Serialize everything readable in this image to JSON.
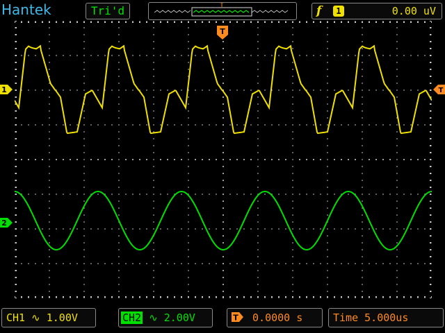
{
  "header": {
    "brand": "Hantek",
    "trigger_status": "Tri'd",
    "trigger_marker_label": "T",
    "trigger_edge_symbol": "f",
    "trigger_source": "1",
    "trigger_level": "0.00  uV"
  },
  "markers": {
    "ch1_label": "1",
    "ch2_label": "2",
    "trigger_pos_label": "T"
  },
  "footer": {
    "ch1_name": "CH1",
    "ch1_coupling_symbol": "∿",
    "ch1_scale": "1.00V",
    "ch2_name": "CH2",
    "ch2_coupling_symbol": "∿",
    "ch2_scale": "2.00V",
    "hpos_symbol": "T",
    "hpos_value": "0.0000 s",
    "timebase_label": "Time",
    "timebase_value": "5.000us"
  },
  "colors": {
    "ch1": "#f0e000",
    "ch2": "#00e000",
    "trigger": "#ff8a1e",
    "brand": "#3fb8e8",
    "grid": "#c8c8c8"
  },
  "waveforms": {
    "periods_on_screen": 5,
    "ch1_shape": "clipped-square",
    "ch2_shape": "sine"
  }
}
